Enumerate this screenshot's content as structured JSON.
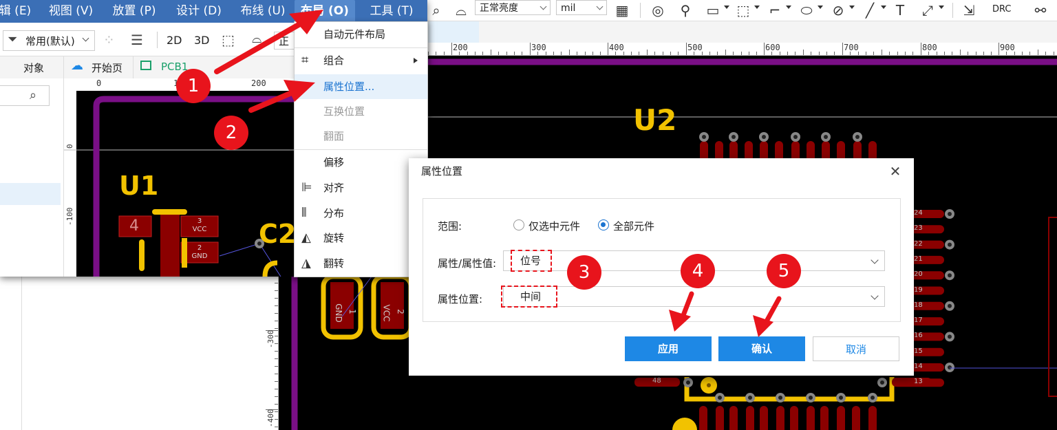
{
  "menubar": {
    "items": [
      "辑 (E)",
      "视图 (V)",
      "放置 (P)",
      "设计 (D)",
      "布线 (U)",
      "布局 (O)",
      "工具 (T)"
    ],
    "active_index": 5
  },
  "toolbar_left": {
    "filter_label": "常用(默认)",
    "view_2d": "2D",
    "view_3d": "3D",
    "truncated_select": "正"
  },
  "tabs": {
    "object": "对象",
    "start_page": "开始页",
    "pcb": "PCB1"
  },
  "toolbar_right": {
    "brightness": "正常亮度",
    "unit": "mil",
    "drc_label": "DRC"
  },
  "rulers": {
    "top_right_labels": [
      "200",
      "300",
      "400",
      "500",
      "600",
      "700",
      "800",
      "900"
    ],
    "inner_top_labels": [
      "0",
      "100",
      "200"
    ],
    "inner_left_labels": [
      "0",
      "-100"
    ],
    "lower_left_labels": [
      "-300",
      "-400"
    ]
  },
  "dropdown": {
    "items": [
      {
        "label": "自动元件布局",
        "icon": "",
        "submenu": false,
        "state": "normal"
      },
      {
        "label": "组合",
        "icon": "group-icon",
        "submenu": true,
        "state": "normal"
      },
      {
        "label": "属性位置...",
        "icon": "",
        "submenu": false,
        "state": "highlighted"
      },
      {
        "label": "互换位置",
        "icon": "",
        "submenu": false,
        "state": "disabled"
      },
      {
        "label": "翻面",
        "icon": "",
        "submenu": false,
        "state": "disabled"
      },
      {
        "label": "偏移",
        "icon": "",
        "submenu": true,
        "state": "normal"
      },
      {
        "label": "对齐",
        "icon": "align-icon",
        "submenu": true,
        "state": "normal"
      },
      {
        "label": "分布",
        "icon": "distribute-icon",
        "submenu": true,
        "state": "normal"
      },
      {
        "label": "旋转",
        "icon": "rotate-icon",
        "submenu": true,
        "state": "normal"
      },
      {
        "label": "翻转",
        "icon": "flip-icon",
        "submenu": true,
        "state": "normal"
      }
    ]
  },
  "dialog": {
    "title": "属性位置",
    "range_label": "范围:",
    "range_options": [
      "仅选中元件",
      "全部元件"
    ],
    "range_selected": 1,
    "attr_label": "属性/属性值:",
    "attr_value": "位号",
    "pos_label": "属性位置:",
    "pos_value": "中间",
    "apply": "应用",
    "confirm": "确认",
    "cancel": "取消"
  },
  "pcb": {
    "u1": "U1",
    "u2": "U2",
    "c2": "C2",
    "pad_4": "4",
    "pad_3": "3",
    "pad_3_net": "VCC",
    "pad_2": "2",
    "pad_2_net": "GND",
    "cap_pad_1": "1",
    "cap_pad_1_net": "GND",
    "cap_pad_2": "2",
    "cap_pad_2_net": "VCC",
    "right_pins": [
      "24",
      "23",
      "22",
      "21",
      "20",
      "19",
      "18",
      "17",
      "16",
      "15",
      "14",
      "13"
    ],
    "pin_48": "48"
  },
  "annotations": [
    "1",
    "2",
    "3",
    "4",
    "5"
  ],
  "colors": {
    "menubar": "#3b6fb6",
    "accent": "#1e88e5",
    "annotation_red": "#e8141c",
    "silkscreen": "#f2c200",
    "pad": "#8b0000",
    "board_outline": "#7a0f86"
  }
}
